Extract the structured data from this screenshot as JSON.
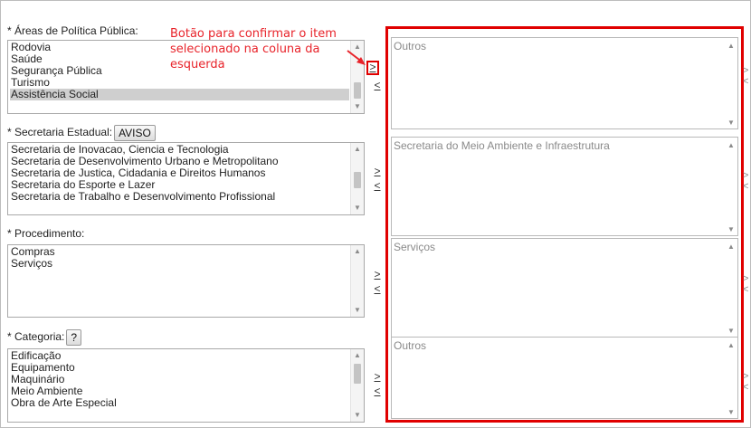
{
  "annotation": {
    "line1": "Botão para confirmar o item",
    "line2": "selecionado na coluna da",
    "line3": "esquerda"
  },
  "areas": {
    "label": "* Áreas de Política Pública:",
    "items": [
      "Rodovia",
      "Saúde",
      "Segurança Pública",
      "Turismo",
      "Assistência Social"
    ],
    "selected_index": 4
  },
  "secretaria": {
    "label": "* Secretaria Estadual:",
    "button": "AVISO",
    "items": [
      "Secretaria de Inovacao, Ciencia e Tecnologia",
      "Secretaria de Desenvolvimento Urbano e Metropolitano",
      "Secretaria de Justica, Cidadania e Direitos Humanos",
      "Secretaria do Esporte e Lazer",
      "Secretaria de Trabalho e Desenvolvimento Profissional"
    ]
  },
  "procedimento": {
    "label": "* Procedimento:",
    "items": [
      "Compras",
      "Serviços"
    ]
  },
  "categoria": {
    "label": "* Categoria:",
    "button": "?",
    "items": [
      "Edificação",
      "Equipamento",
      "Maquinário",
      "Meio Ambiente",
      "Obra de Arte Especial"
    ]
  },
  "move": {
    "add": ">",
    "remove": "<"
  },
  "selected": {
    "areas": "Outros",
    "secretaria": "Secretaria do Meio Ambiente e Infraestrutura",
    "procedimento": "Serviços",
    "categoria": "Outros"
  },
  "colors": {
    "highlight": "#e00000",
    "annotation": "#e8232a",
    "selected_row": "#cfcfcf"
  },
  "icons": {
    "scroll_up": "triangle-up-icon",
    "scroll_down": "triangle-down-icon",
    "arrow": "red-arrow-icon"
  }
}
